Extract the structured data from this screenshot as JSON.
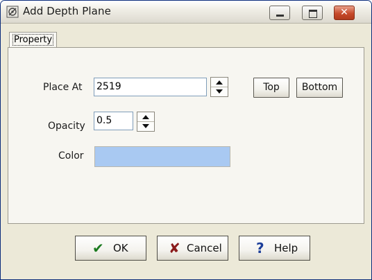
{
  "window": {
    "title": "Add Depth Plane",
    "close_symbol": "✕"
  },
  "tabs": [
    {
      "label": "Property"
    }
  ],
  "form": {
    "place_at": {
      "label": "Place At",
      "value": "2519"
    },
    "top_button": "Top",
    "bottom_button": "Bottom",
    "opacity": {
      "label": "Opacity",
      "value": "0.5"
    },
    "color": {
      "label": "Color",
      "value": "#a9c9f2"
    }
  },
  "footer": {
    "ok": {
      "icon": "check-icon",
      "glyph": "✔",
      "label": "OK"
    },
    "cancel": {
      "icon": "x-icon",
      "glyph": "✘",
      "label": "Cancel"
    },
    "help": {
      "icon": "question-icon",
      "glyph": "?",
      "label": "Help"
    }
  },
  "colors": {
    "ok_icon": "#1b7a1f",
    "cancel_icon": "#8b1c1c",
    "help_icon": "#1d3f9a",
    "accent": "#0a2c7a"
  }
}
